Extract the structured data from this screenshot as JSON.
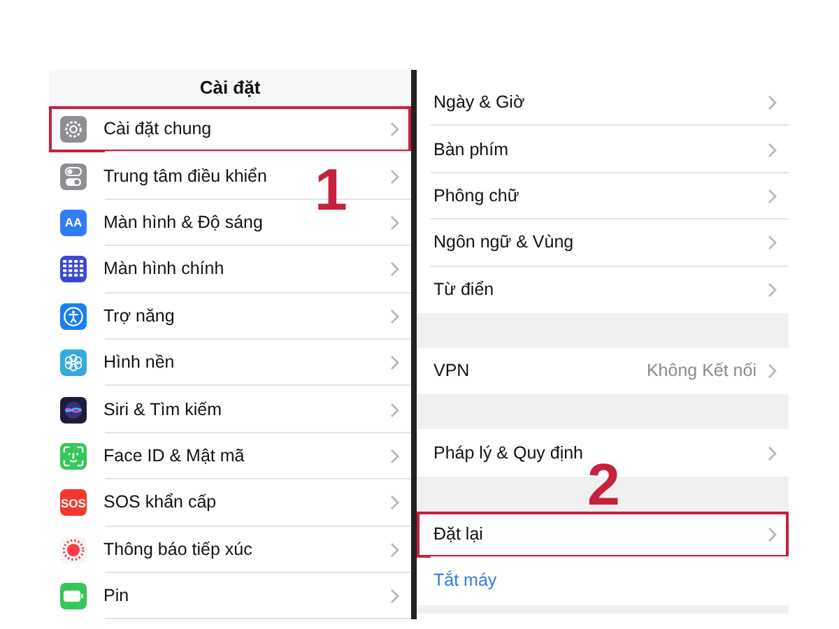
{
  "left_panel": {
    "title": "Cài đặt",
    "items": [
      {
        "label": "Cài đặt chung",
        "highlighted": true,
        "step": "1"
      },
      {
        "label": "Trung tâm điều khiển",
        "highlighted": false
      },
      {
        "label": "Màn hình & Độ sáng",
        "badge_text": "AA",
        "highlighted": false
      },
      {
        "label": "Màn hình chính",
        "highlighted": false
      },
      {
        "label": "Trợ năng",
        "highlighted": false
      },
      {
        "label": "Hình nền",
        "highlighted": false
      },
      {
        "label": "Siri & Tìm kiếm",
        "highlighted": false
      },
      {
        "label": "Face ID & Mật mã",
        "highlighted": false
      },
      {
        "label": "SOS khẩn cấp",
        "badge_text": "SOS",
        "highlighted": false
      },
      {
        "label": "Thông báo tiếp xúc",
        "highlighted": false
      },
      {
        "label": "Pin",
        "highlighted": false
      }
    ]
  },
  "right_panel": {
    "groups": [
      [
        {
          "label": "Ngày & Giờ",
          "kind": "row",
          "highlighted": false
        },
        {
          "label": "Bàn phím",
          "kind": "row",
          "highlighted": false
        },
        {
          "label": "Phông chữ",
          "kind": "row",
          "highlighted": false
        },
        {
          "label": "Ngôn ngữ & Vùng",
          "kind": "row",
          "highlighted": false
        },
        {
          "label": "Từ điển",
          "kind": "row",
          "highlighted": false
        }
      ],
      [
        {
          "label": "VPN",
          "value": "Không Kết nối",
          "kind": "row",
          "highlighted": false
        }
      ],
      [
        {
          "label": "Pháp lý & Quy định",
          "kind": "row",
          "highlighted": false
        }
      ],
      [
        {
          "label": "Đặt lại",
          "kind": "row",
          "highlighted": true,
          "step": "2"
        },
        {
          "label": "Tắt máy",
          "kind": "link",
          "highlighted": false
        }
      ]
    ]
  }
}
